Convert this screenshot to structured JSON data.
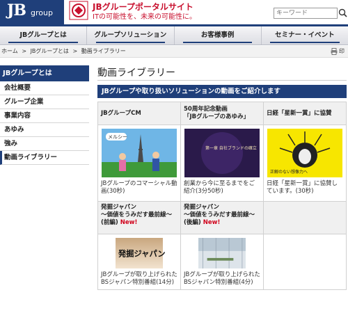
{
  "header": {
    "logo_main": "JB",
    "logo_sub": "group",
    "brand_title": "JBグループポータルサイト",
    "brand_subtitle": "ITの可能性を、未来の可能性に。",
    "search_placeholder": "キーワード"
  },
  "nav": {
    "items": [
      "JBグループとは",
      "グループソリューション",
      "お客様事例",
      "セミナー・イベント"
    ]
  },
  "breadcrumb": {
    "items": [
      "ホーム",
      ">",
      "JBグループとは",
      ">",
      "動画ライブラリー"
    ],
    "print_label": "印"
  },
  "sidebar": {
    "heading": "JBグループとは",
    "items": [
      "会社概要",
      "グループ企業",
      "事業内容",
      "あゆみ",
      "強み",
      "動画ライブラリー"
    ]
  },
  "main": {
    "page_title": "動画ライブラリー",
    "section_title": "JBグループや取り扱いソリューションの動画をご紹介します",
    "videos_row1": [
      {
        "title": "JBグループCM",
        "caption": "JBグループのコマーシャル動画(30秒)",
        "thumb_text": "メルシー"
      },
      {
        "title": "50周年記念動画「JBグループのあゆみ」",
        "title_line1": "50周年記念動画",
        "title_line2": "「JBグループのあゆみ」",
        "caption": "創業から今に至るまでをご紹介(3分50秒)",
        "thumb_text": "第一章 自社ブランドの確立"
      },
      {
        "title": "日経「星新一賞」に協賛",
        "caption": "日経「星新一賞」に協賛しています。(30秒)",
        "thumb_text": "正解のない想像力へ"
      }
    ],
    "videos_row2": [
      {
        "title_line1": "発掘ジャパン",
        "title_line2": "〜価値をうみだす最前線〜",
        "title_line3": "(前編)",
        "new_label": "New!",
        "caption": "JBグループが取り上げられたBSジャパン特別番組(14分)",
        "thumb_text": "発掘ジャパン"
      },
      {
        "title_line1": "発掘ジャパン",
        "title_line2": "〜価値をうみだす最前線〜",
        "title_line3": "(後編)",
        "new_label": "New!",
        "caption": "JBグループが取り上げられたBSジャパン特別番組(4分)",
        "thumb_text": ""
      }
    ]
  },
  "colors": {
    "navy": "#1f3f7a",
    "red": "#c8102e",
    "new_red": "#d0021b"
  }
}
